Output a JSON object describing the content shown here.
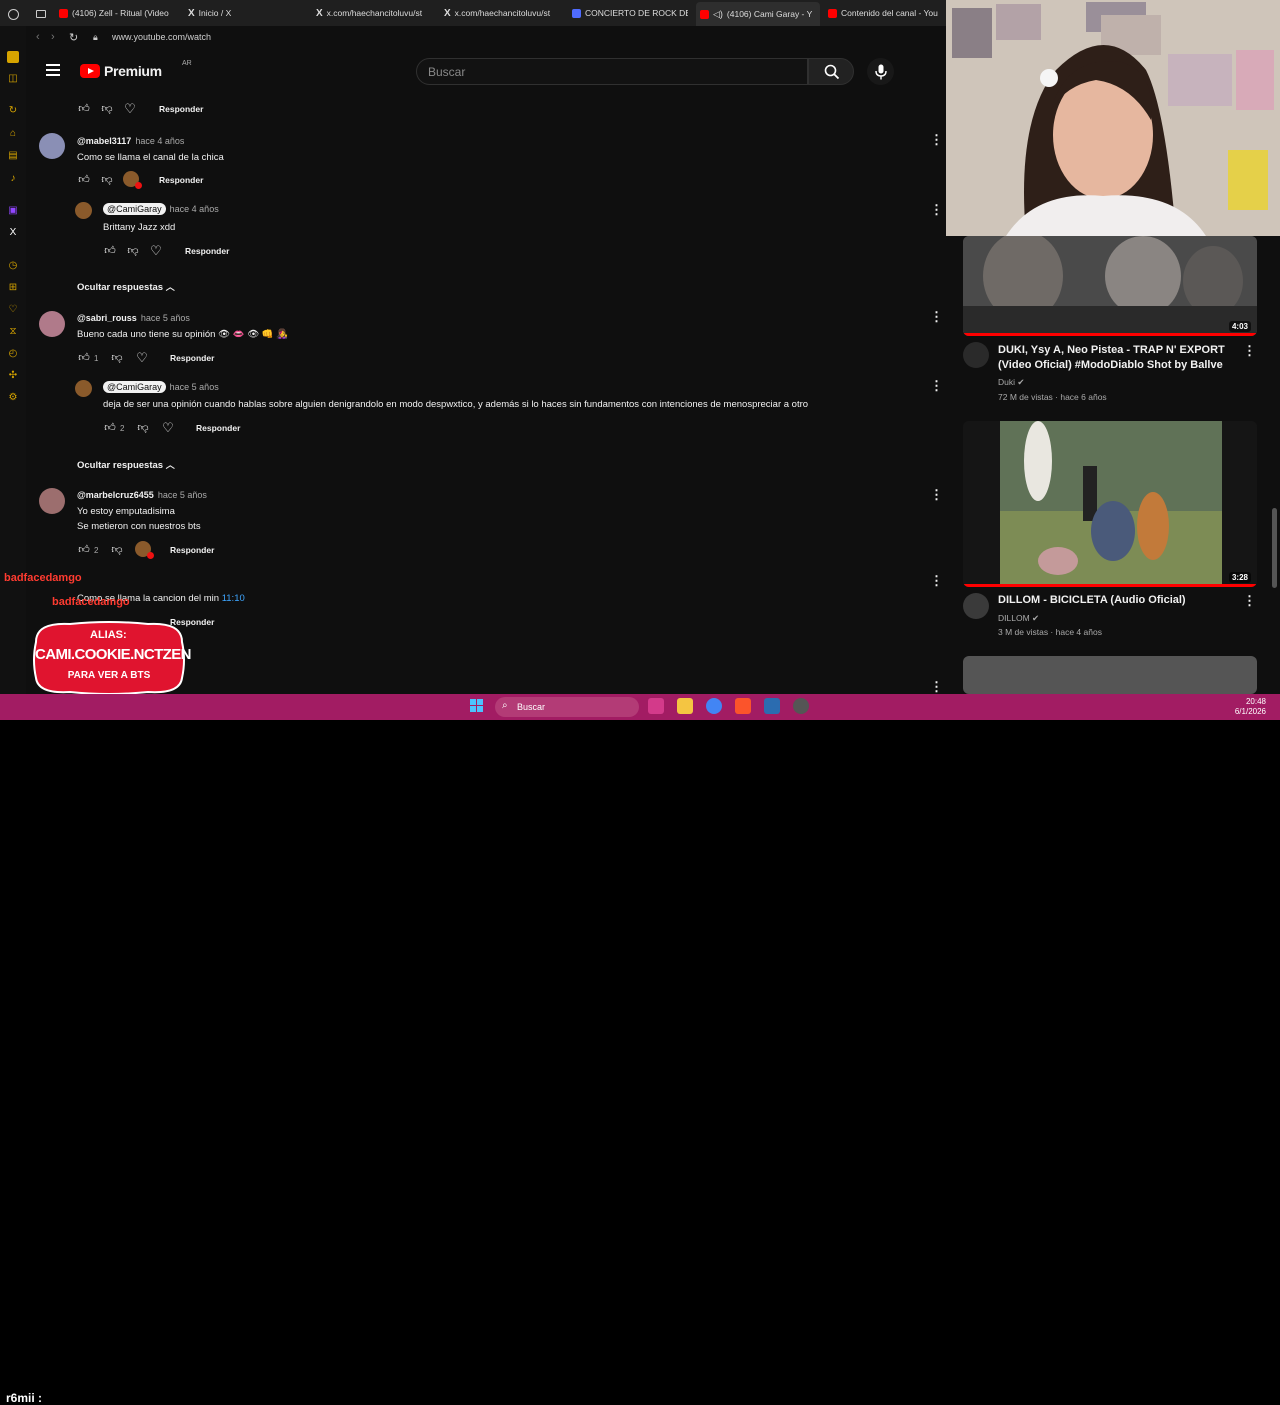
{
  "browser": {
    "tabs": [
      {
        "label": "(4106) Zell - Ritual (Video",
        "color": "#ff0000"
      },
      {
        "label": "Inicio / X",
        "color": "#ffffff"
      },
      {
        "label": "x.com/haechancitoluvu/st",
        "color": "#ffffff"
      },
      {
        "label": "x.com/haechancitoluvu/st",
        "color": "#ffffff"
      },
      {
        "label": "CONCIERTO DE ROCK DE",
        "color": "#4f6bff"
      },
      {
        "label": "(4106) Cami Garay - Y",
        "color": "#ff0000"
      },
      {
        "label": "Contenido del canal - You",
        "color": "#ff0000"
      }
    ],
    "url": "www.youtube.com/watch"
  },
  "header": {
    "brand": "Premium",
    "country": "AR",
    "search_placeholder": "Buscar"
  },
  "comments": [
    {
      "reply_label": "Responder"
    },
    {
      "author": "@mabel3117",
      "time": "hace 4 años",
      "text": "Como se llama el canal de la chica",
      "reply_label": "Responder"
    },
    {
      "author": "@CamiGaray",
      "time": "hace 4 años",
      "text": "Brittany Jazz xdd",
      "reply_label": "Responder"
    },
    {
      "hide_label": "Ocultar respuestas"
    },
    {
      "author": "@sabri_rouss",
      "time": "hace 5 años",
      "text": "Bueno cada uno tiene su  opinión 👁 👄 👁 👊 👩‍🎤",
      "likes": "1",
      "reply_label": "Responder"
    },
    {
      "author": "@CamiGaray",
      "time": "hace 5 años",
      "text": "deja de ser una opinión cuando hablas sobre alguien denigrandolo en modo despwxtico, y además si lo haces sin fundamentos con intenciones de menospreciar a otro",
      "likes": "2",
      "reply_label": "Responder"
    },
    {
      "hide_label": "Ocultar respuestas"
    },
    {
      "author": "@marbelcruz6455",
      "time": "hace 5 años",
      "text": "Yo estoy emputadisima",
      "text2": "Se metieron con nuestros bts",
      "likes": "2",
      "reply_label": "Responder"
    },
    {
      "text": "Como se llama la cancion del min",
      "timestamp": "11:10",
      "reply_label": "Responder"
    }
  ],
  "sidebar": {
    "videos": [
      {
        "title": "DUKI, Ysy A, Neo Pistea - TRAP N' EXPORT (Video Oficial) #ModoDiablo Shot by Ballve",
        "channel": "Duki",
        "meta": "72 M de vistas · hace 6 años",
        "duration": "4:03"
      },
      {
        "title": "DILLOM - BICICLETA (Audio Oficial)",
        "channel": "DILLOM",
        "meta": "3 M de vistas · hace 4 años",
        "duration": "3:28"
      }
    ]
  },
  "overlay": {
    "chat_lines": [
      "badfacedamgo",
      "badfacedamgo"
    ],
    "alias_top": "ALIAS:",
    "alias_name": "CAMI.COOKIE.NCTZEN",
    "alias_bottom": "PARA VER A BTS",
    "chat_user": "r6mii :"
  },
  "taskbar": {
    "search": "Buscar",
    "time": "20:48",
    "date": "6/1/2026"
  }
}
